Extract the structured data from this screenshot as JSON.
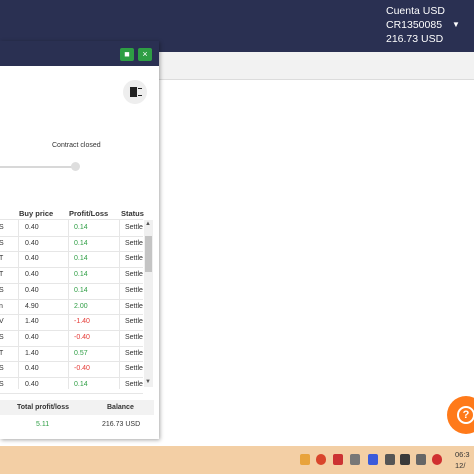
{
  "account": {
    "line1": "Cuenta USD",
    "line2": "CR1350085",
    "balance": "216.73 USD"
  },
  "panel": {
    "status_text": "Contract closed"
  },
  "table": {
    "headers": [
      "Buy price",
      "Profit/Loss",
      "Status"
    ],
    "rows": [
      {
        "lead": "S",
        "buy": "0.40",
        "pl": "0.14",
        "sign": "pos",
        "status": "Settle"
      },
      {
        "lead": "S",
        "buy": "0.40",
        "pl": "0.14",
        "sign": "pos",
        "status": "Settle"
      },
      {
        "lead": "T",
        "buy": "0.40",
        "pl": "0.14",
        "sign": "pos",
        "status": "Settle"
      },
      {
        "lead": "T",
        "buy": "0.40",
        "pl": "0.14",
        "sign": "pos",
        "status": "Settle"
      },
      {
        "lead": "S",
        "buy": "0.40",
        "pl": "0.14",
        "sign": "pos",
        "status": "Settle"
      },
      {
        "lead": "n",
        "buy": "4.90",
        "pl": "2.00",
        "sign": "pos",
        "status": "Settle"
      },
      {
        "lead": "V",
        "buy": "1.40",
        "pl": "-1.40",
        "sign": "neg",
        "status": "Settle"
      },
      {
        "lead": "S",
        "buy": "0.40",
        "pl": "-0.40",
        "sign": "neg",
        "status": "Settle"
      },
      {
        "lead": "T",
        "buy": "1.40",
        "pl": "0.57",
        "sign": "pos",
        "status": "Settle"
      },
      {
        "lead": "S",
        "buy": "0.40",
        "pl": "-0.40",
        "sign": "neg",
        "status": "Settle"
      },
      {
        "lead": "S",
        "buy": "0.40",
        "pl": "0.14",
        "sign": "pos",
        "status": "Settle"
      }
    ]
  },
  "totals": {
    "profit_label": "Total profit/loss",
    "balance_label": "Balance",
    "profit_value": "5.11",
    "balance_value": "216.73 USD"
  },
  "help": {
    "symbol": "?"
  },
  "clock": {
    "time": "06:3",
    "date": "12/"
  },
  "colors": {
    "nav": "#2a3052",
    "positive": "#2e9e44",
    "negative": "#e53935",
    "help": "#ff7a1a",
    "taskbar": "#f3cfa5"
  },
  "icons": [
    "save-icon",
    "close-icon",
    "trash-icon",
    "help-icon",
    "dropdown-caret-icon"
  ]
}
